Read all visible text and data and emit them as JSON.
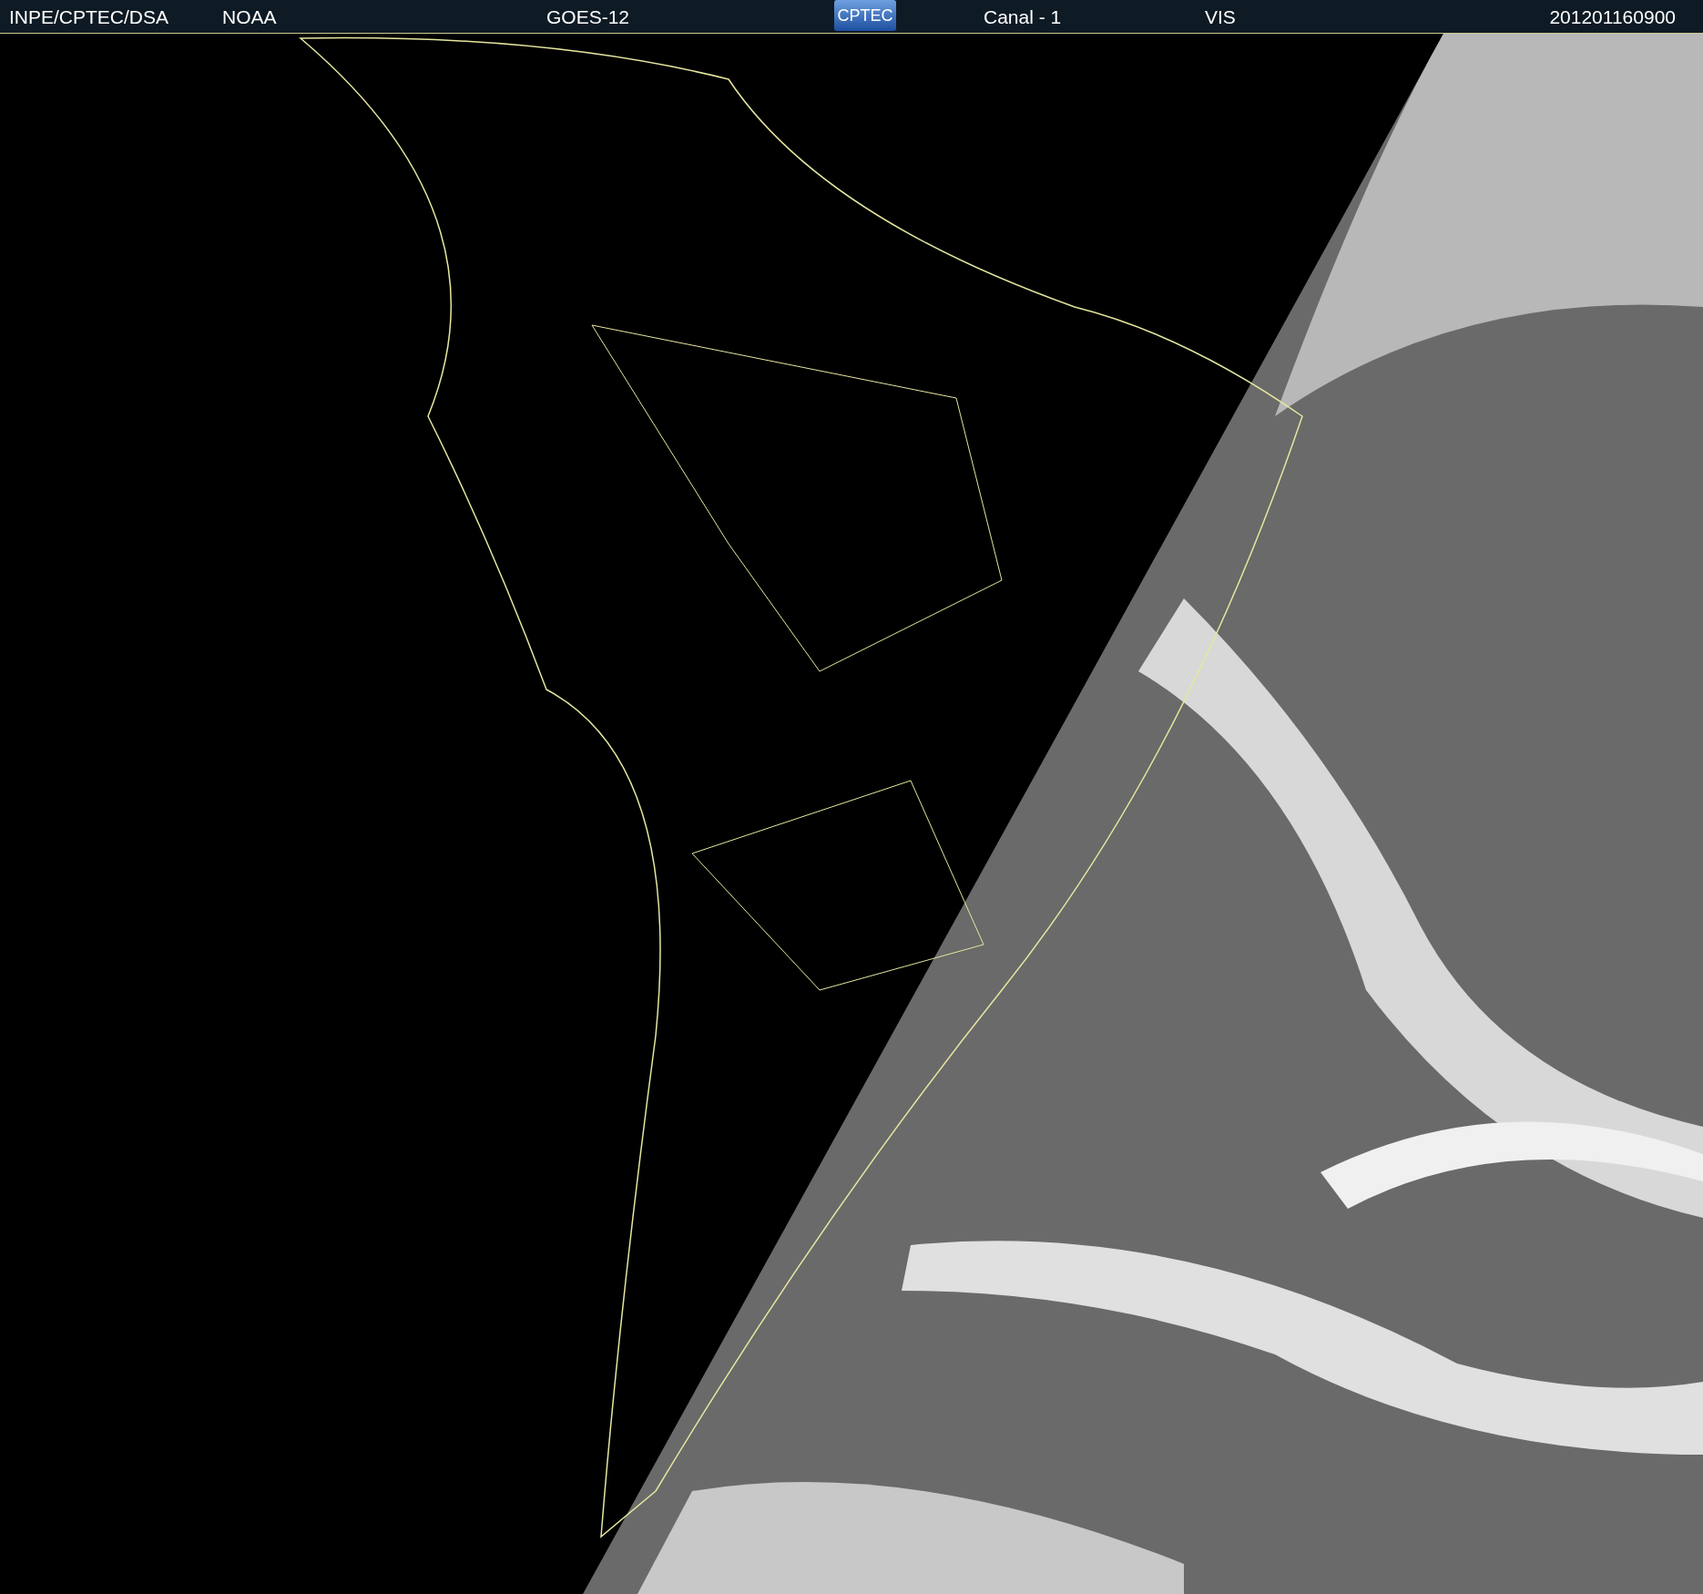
{
  "header": {
    "source": "INPE/CPTEC/DSA",
    "agency": "NOAA",
    "satellite": "GOES-12",
    "logo": "CPTEC",
    "channel": "Canal - 1",
    "band": "VIS",
    "timestamp": "201201160900"
  }
}
